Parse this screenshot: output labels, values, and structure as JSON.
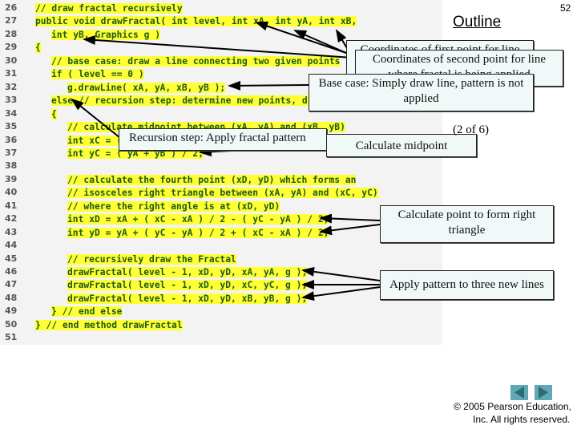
{
  "slide": {
    "number": "52",
    "outline_label": "Outline",
    "page_indicator": "(2 of 6)",
    "copyright_line1": "© 2005 Pearson Education,",
    "copyright_line2": "Inc.  All rights reserved."
  },
  "code": {
    "lines": [
      {
        "n": "26",
        "t": "// draw fractal recursively",
        "i": 0
      },
      {
        "n": "27",
        "t": "public void drawFractal( int level, int xA, int yA, int xB,",
        "i": 0
      },
      {
        "n": "28",
        "t": "int yB, Graphics g )",
        "i": 1
      },
      {
        "n": "29",
        "t": "{",
        "i": 0
      },
      {
        "n": "30",
        "t": "// base case: draw a line connecting two given points",
        "i": 1
      },
      {
        "n": "31",
        "t": "if ( level == 0 )",
        "i": 1
      },
      {
        "n": "32",
        "t": "g.drawLine( xA, yA, xB, yB );",
        "i": 2
      },
      {
        "n": "33",
        "t": "else // recursion step: determine new points, draw next level",
        "i": 1
      },
      {
        "n": "34",
        "t": "{",
        "i": 1
      },
      {
        "n": "35",
        "t": "// calculate midpoint between (xA, yA) and (xB, yB)",
        "i": 2
      },
      {
        "n": "36",
        "t": "int xC = ( xA + xB ) / 2;",
        "i": 2
      },
      {
        "n": "37",
        "t": "int yC = ( yA + yB ) / 2;",
        "i": 2
      },
      {
        "n": "38",
        "t": "",
        "i": 0
      },
      {
        "n": "39",
        "t": "// calculate the fourth point (xD, yD) which forms an",
        "i": 2
      },
      {
        "n": "40",
        "t": "// isosceles right triangle between (xA, yA) and (xC, yC)",
        "i": 2
      },
      {
        "n": "41",
        "t": "// where the right angle is at (xD, yD)",
        "i": 2
      },
      {
        "n": "42",
        "t": "int xD = xA + ( xC - xA ) / 2 - ( yC - yA ) / 2;",
        "i": 2
      },
      {
        "n": "43",
        "t": "int yD = yA + ( yC - yA ) / 2 + ( xC - xA ) / 2;",
        "i": 2
      },
      {
        "n": "44",
        "t": "",
        "i": 0
      },
      {
        "n": "45",
        "t": "// recursively draw the Fractal",
        "i": 2
      },
      {
        "n": "46",
        "t": "drawFractal( level - 1, xD, yD, xA, yA, g );",
        "i": 2
      },
      {
        "n": "47",
        "t": "drawFractal( level - 1, xD, yD, xC, yC, g );",
        "i": 2
      },
      {
        "n": "48",
        "t": "drawFractal( level - 1, xD, yD, xB, yB, g );",
        "i": 2
      },
      {
        "n": "49",
        "t": "} // end else",
        "i": 1
      },
      {
        "n": "50",
        "t": "} // end method drawFractal",
        "i": 0
      },
      {
        "n": "51",
        "t": "",
        "i": 0
      }
    ]
  },
  "callouts": {
    "first_point": "Coordinates of first point for line where fractal is being applied",
    "second_point": "Coordinates of second point for line where fractal is being applied",
    "base_case": "Base case: Simply draw line, pattern is not applied",
    "recursion_step": "Recursion step: Apply fractal pattern",
    "midpoint": "Calculate midpoint",
    "right_triangle": "Calculate point to form right triangle",
    "apply_pattern": "Apply pattern to three new lines"
  },
  "nav": {
    "prev_icon": "triangle-left-icon",
    "next_icon": "triangle-right-icon",
    "color": "#5fa8b4"
  }
}
